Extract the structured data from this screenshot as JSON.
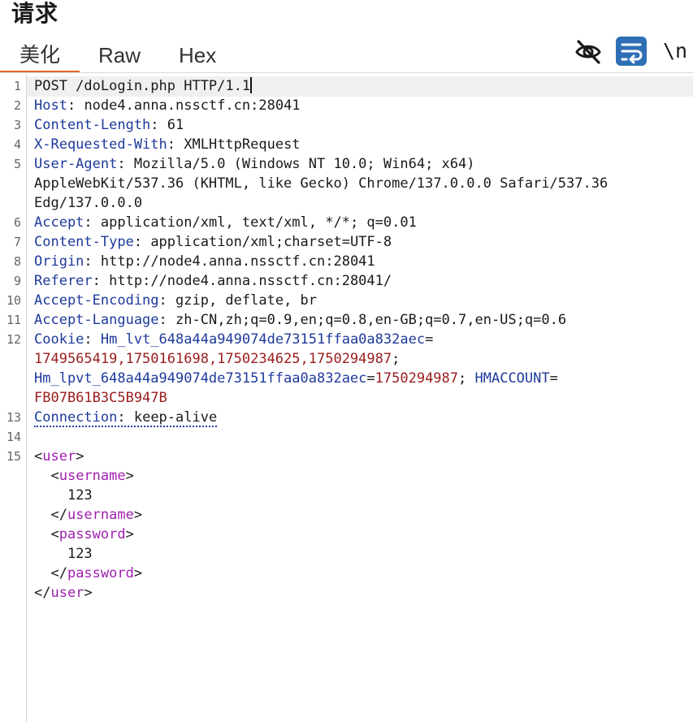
{
  "panel": {
    "title": "请求"
  },
  "tabs": [
    {
      "label": "美化",
      "active": true
    },
    {
      "label": "Raw",
      "active": false
    },
    {
      "label": "Hex",
      "active": false
    }
  ],
  "toolbar": {
    "hide_icon": "eye-slash-icon",
    "wrap_icon": "wrap-lines-icon",
    "newline_label": "\\n"
  },
  "line_numbers": [
    "1",
    "2",
    "3",
    "4",
    "5",
    "6",
    "7",
    "8",
    "9",
    "10",
    "11",
    "12",
    "13",
    "14",
    "15"
  ],
  "request": {
    "request_line": "POST /doLogin.php HTTP/1.1",
    "headers": [
      {
        "name": "Host",
        "value": "node4.anna.nssctf.cn:28041"
      },
      {
        "name": "Content-Length",
        "value": "61"
      },
      {
        "name": "X-Requested-With",
        "value": "XMLHttpRequest"
      },
      {
        "name": "User-Agent",
        "value": "Mozilla/5.0 (Windows NT 10.0; Win64; x64)",
        "cont1": "AppleWebKit/537.36 (KHTML, like Gecko) Chrome/137.0.0.0 Safari/537.36",
        "cont2": "Edg/137.0.0.0"
      },
      {
        "name": "Accept",
        "value": "application/xml, text/xml, */*; q=0.01"
      },
      {
        "name": "Content-Type",
        "value": "application/xml;charset=UTF-8"
      },
      {
        "name": "Origin",
        "value": "http://node4.anna.nssctf.cn:28041"
      },
      {
        "name": "Referer",
        "value": "http://node4.anna.nssctf.cn:28041/"
      },
      {
        "name": "Accept-Encoding",
        "value": "gzip, deflate, br"
      },
      {
        "name": "Accept-Language",
        "value": "zh-CN,zh;q=0.9,en;q=0.8,en-GB;q=0.7,en-US;q=0.6"
      },
      {
        "name": "Cookie"
      },
      {
        "name": "Connection",
        "value": "keep-alive"
      }
    ],
    "cookie": {
      "c1_name": "Hm_lvt_648a44a949074de73151ffaa0a832aec",
      "c1_value": "1749565419,1750161698,1750234625,1750294987",
      "c2_name": "Hm_lpvt_648a44a949074de73151ffaa0a832aec",
      "c2_value": "1750294987",
      "c3_name": "HMACCOUNT",
      "c3_value": "FB07B61B3C5B947B"
    },
    "body": {
      "root_tag": "user",
      "username_tag": "username",
      "username_value": "123",
      "password_tag": "password",
      "password_value": "123"
    }
  }
}
